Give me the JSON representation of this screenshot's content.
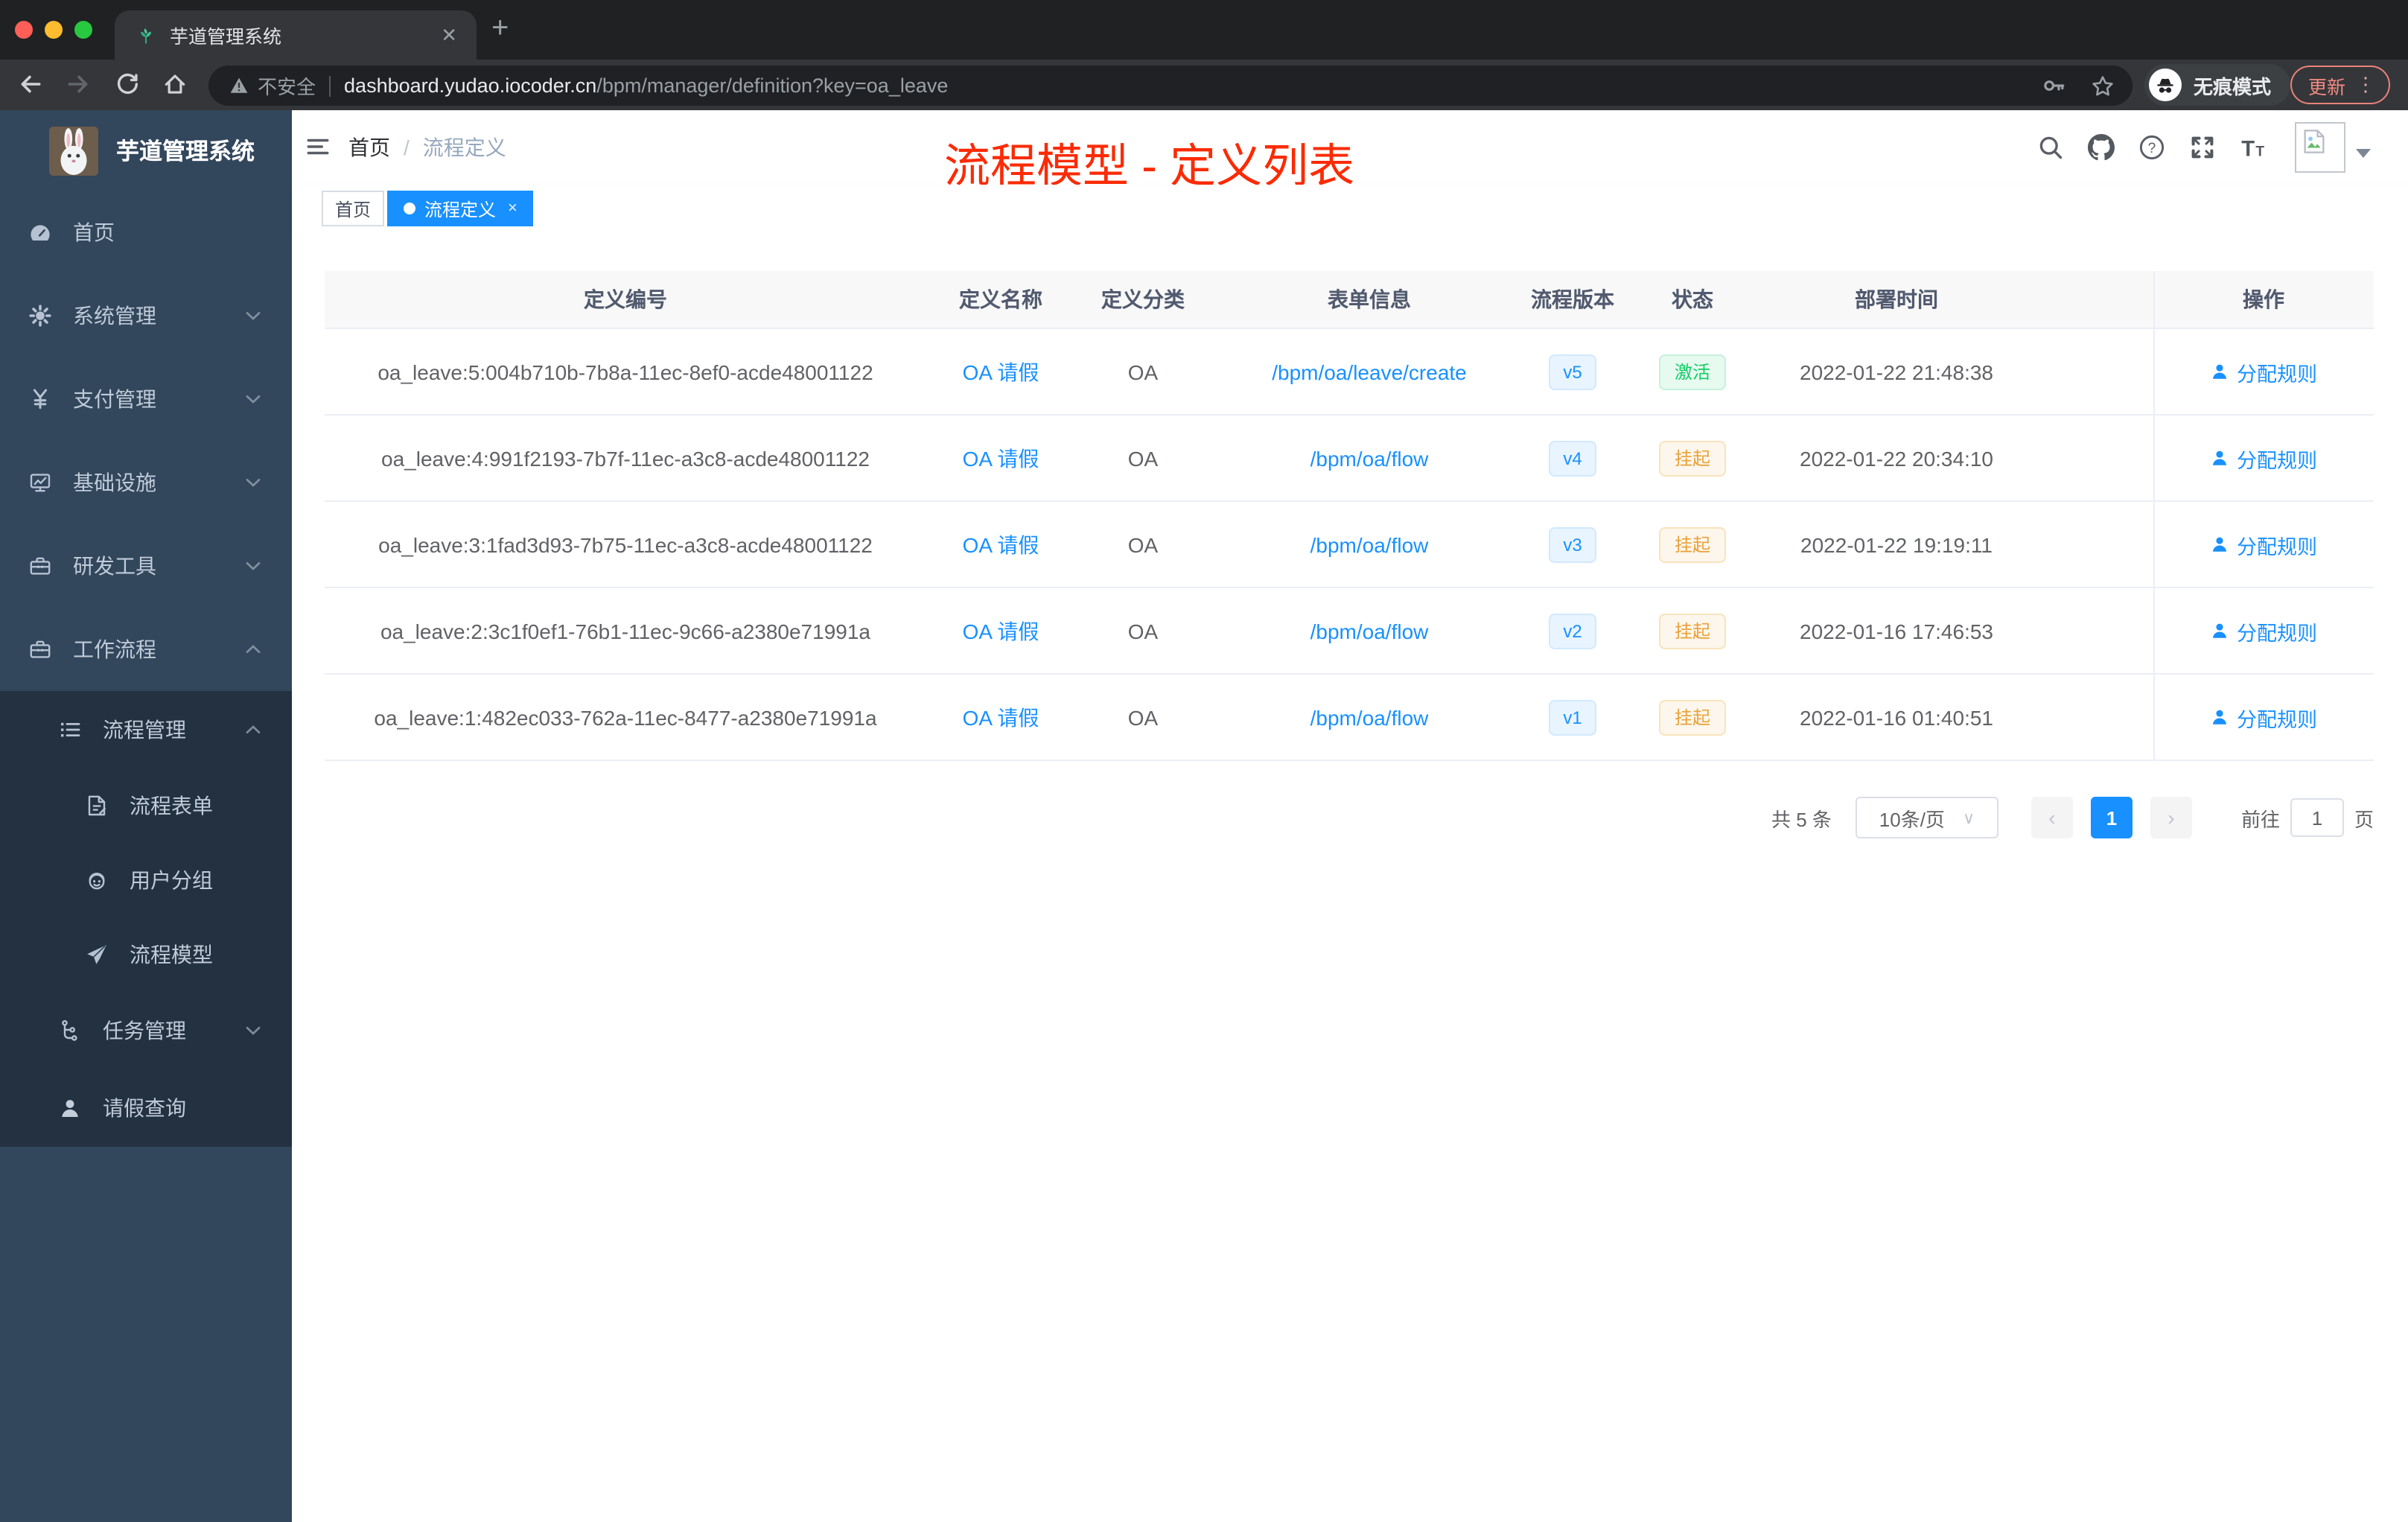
{
  "browser": {
    "tab_title": "芋道管理系统",
    "new_tab": "+",
    "close_tab": "✕",
    "security_label": "不安全",
    "url_host": "dashboard.yudao.iocoder.cn",
    "url_path": "/bpm/manager/definition?key=oa_leave",
    "incognito_label": "无痕模式",
    "update_label": "更新",
    "menu_dots": "⋮"
  },
  "sidebar": {
    "title": "芋道管理系统",
    "items": [
      {
        "label": "首页",
        "icon": "dashboard-icon",
        "level": 1
      },
      {
        "label": "系统管理",
        "icon": "gear-icon",
        "level": 1,
        "chevron": "down"
      },
      {
        "label": "支付管理",
        "icon": "yen-icon",
        "level": 1,
        "chevron": "down"
      },
      {
        "label": "基础设施",
        "icon": "monitor-icon",
        "level": 1,
        "chevron": "down"
      },
      {
        "label": "研发工具",
        "icon": "toolbox-icon",
        "level": 1,
        "chevron": "down"
      },
      {
        "label": "工作流程",
        "icon": "briefcase-icon",
        "level": 1,
        "chevron": "up"
      },
      {
        "label": "流程管理",
        "icon": "list-icon",
        "level": 2,
        "chevron": "up"
      },
      {
        "label": "流程表单",
        "icon": "form-icon",
        "level": 3
      },
      {
        "label": "用户分组",
        "icon": "robot-icon",
        "level": 3
      },
      {
        "label": "流程模型",
        "icon": "send-icon",
        "level": 3
      },
      {
        "label": "任务管理",
        "icon": "flow-icon",
        "level": 2,
        "chevron": "down"
      },
      {
        "label": "请假查询",
        "icon": "user-icon",
        "level": 2
      }
    ]
  },
  "header": {
    "breadcrumb": [
      "首页",
      "流程定义"
    ],
    "breadcrumb_separator": "/",
    "annotation": "流程模型 - 定义列表"
  },
  "tags": [
    {
      "label": "首页",
      "active": false
    },
    {
      "label": "流程定义",
      "active": true,
      "close": "×"
    }
  ],
  "table": {
    "headers": [
      "定义编号",
      "定义名称",
      "定义分类",
      "表单信息",
      "流程版本",
      "状态",
      "部署时间",
      "操作"
    ],
    "action_label": "分配规则",
    "rows": [
      {
        "id": "oa_leave:5:004b710b-7b8a-11ec-8ef0-acde48001122",
        "name": "OA 请假",
        "category": "OA",
        "form": "/bpm/oa/leave/create",
        "version": "v5",
        "status": "激活",
        "status_type": "success",
        "deploy_time": "2022-01-22 21:48:38"
      },
      {
        "id": "oa_leave:4:991f2193-7b7f-11ec-a3c8-acde48001122",
        "name": "OA 请假",
        "category": "OA",
        "form": "/bpm/oa/flow",
        "version": "v4",
        "status": "挂起",
        "status_type": "warning",
        "deploy_time": "2022-01-22 20:34:10"
      },
      {
        "id": "oa_leave:3:1fad3d93-7b75-11ec-a3c8-acde48001122",
        "name": "OA 请假",
        "category": "OA",
        "form": "/bpm/oa/flow",
        "version": "v3",
        "status": "挂起",
        "status_type": "warning",
        "deploy_time": "2022-01-22 19:19:11"
      },
      {
        "id": "oa_leave:2:3c1f0ef1-76b1-11ec-9c66-a2380e71991a",
        "name": "OA 请假",
        "category": "OA",
        "form": "/bpm/oa/flow",
        "version": "v2",
        "status": "挂起",
        "status_type": "warning",
        "deploy_time": "2022-01-16 17:46:53"
      },
      {
        "id": "oa_leave:1:482ec033-762a-11ec-8477-a2380e71991a",
        "name": "OA 请假",
        "category": "OA",
        "form": "/bpm/oa/flow",
        "version": "v1",
        "status": "挂起",
        "status_type": "warning",
        "deploy_time": "2022-01-16 01:40:51"
      }
    ]
  },
  "pagination": {
    "total": "共 5 条",
    "page_size": "10条/页",
    "prev": "‹",
    "current": "1",
    "next": "›",
    "goto_label": "前往",
    "goto_value": "1",
    "unit": "页"
  },
  "colors": {
    "accent": "#1890ff",
    "success": "#13ce66",
    "warning": "#e6a23c",
    "annotation_red": "#fb2b05",
    "sidebar_bg": "#32465c",
    "submenu_bg": "#243140"
  }
}
